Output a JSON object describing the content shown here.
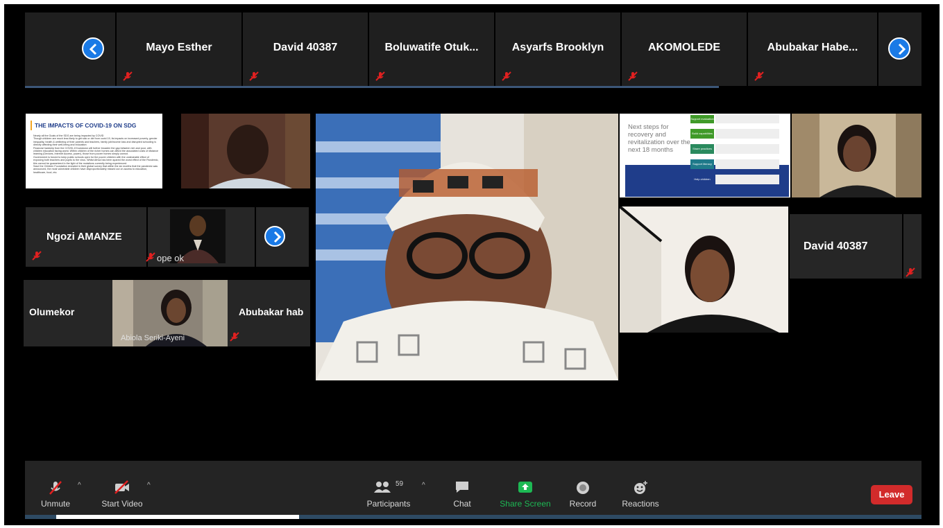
{
  "top_strip": {
    "participants": [
      "Mayo Esther",
      "David 40387",
      "Boluwatife  Otuk...",
      "Asyarfs Brooklyn",
      "AKOMOLEDE",
      "Abubakar  Habe..."
    ]
  },
  "slide1": {
    "title": "THE IMPACTS OF COVID-19 ON SDG",
    "bullets": [
      "Nearly all the Goals of the SDG are being impacted by COVID",
      "Though children are much less likely to get sick or die from covid 19, its impacts on increased poverty, gender inequality, health & wellbeing of their parents and teachers, family job/income loss and disrupted schooling is directly affecting their well-being and education",
      "Financial hardship from the COVID-19 lockdown will further broaden the gap between rich and poor, with children education facing worst. Within children of the richer homes can afford the associated costs of distance learning (Devices, Internet Access, power), those from poorer homes simply cannot.",
      "Government is forced to keep public schools open for the poorer children with the undesirable effect of exposing both teachers and pupils to the virus. Whilst Africa has been spared the worst effect of the Pandemic, this cannot be guaranteed in the light of the mutations currently being experienced.",
      "Save the Children Foundation revealed in their global survey that within the six months that the pandemic was announced, the most vulnerable children have disproportionately missed out on access to education, healthcare, food, etc."
    ]
  },
  "row2": {
    "left_name": "Ngozi AMANZE",
    "right_name": "ope ok"
  },
  "row3": {
    "left_name": "Olumekor",
    "video_caption": "Abiola Seriki-Ayeni",
    "right_name": "Abubakar  hab"
  },
  "slide2": {
    "heading": "Next steps for recovery and revitalization over the next 18 months",
    "steps": [
      "Support evaluation",
      "Build capabilities",
      "Share practices",
      "Support literacy",
      "Help children"
    ]
  },
  "right_tile": {
    "name": "David 40387"
  },
  "toolbar": {
    "unmute": "Unmute",
    "start_video": "Start Video",
    "participants": "Participants",
    "participant_count": "59",
    "chat": "Chat",
    "share_screen": "Share Screen",
    "record": "Record",
    "reactions": "Reactions",
    "leave": "Leave"
  },
  "colors": {
    "canvas": "#000000",
    "tile": "#262626",
    "nav_blue": "#1a7ae6",
    "share_green": "#1db954",
    "leave_red": "#d22b2b",
    "mic_red": "#e02020"
  },
  "icons": [
    "chevron-left-icon",
    "chevron-right-icon",
    "mic-off-icon",
    "video-off-icon",
    "participants-icon",
    "chat-icon",
    "share-screen-icon",
    "record-icon",
    "reactions-icon"
  ]
}
